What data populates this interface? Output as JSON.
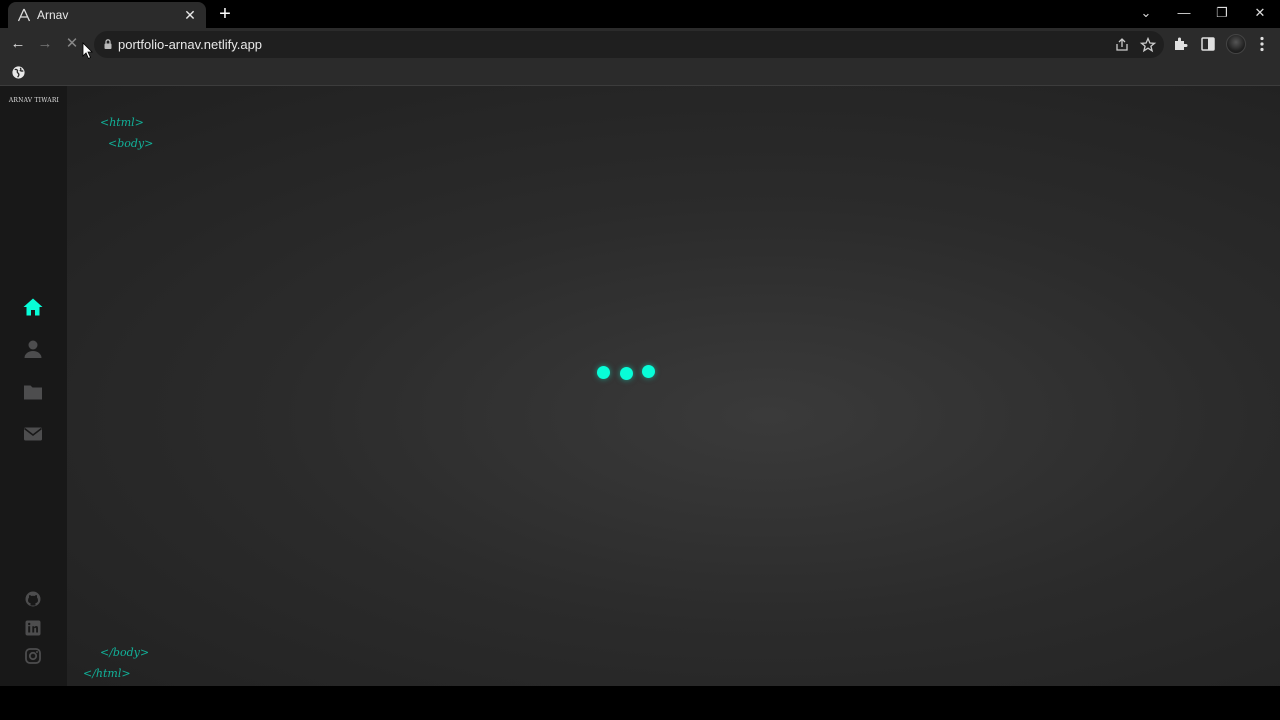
{
  "browser": {
    "tab": {
      "title": "Arnav",
      "close": "✕"
    },
    "new_tab": "+",
    "window_controls": {
      "tab_search": "⌄",
      "minimize": "—",
      "restore": "❐",
      "close": "✕"
    },
    "toolbar": {
      "back": "←",
      "forward": "→",
      "stop": "✕"
    },
    "url": "portfolio-arnav.netlify.app"
  },
  "page": {
    "logo": "ARNAV TIWARI",
    "tags": {
      "html_open": "<html>",
      "body_open": "<body>",
      "body_close": "</body>",
      "html_close": "</html>"
    },
    "nav": [
      "home-icon",
      "user-icon",
      "folder-icon",
      "mail-icon"
    ],
    "social": [
      "github-icon",
      "linkedin-icon",
      "instagram-icon"
    ],
    "colors": {
      "accent": "#08fdd8",
      "nav_inactive": "#4d4d4e",
      "sidebar_bg": "#181818"
    }
  }
}
